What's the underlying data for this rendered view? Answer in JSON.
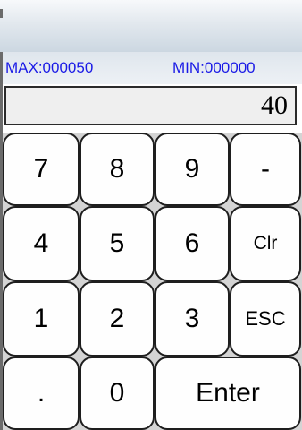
{
  "range": {
    "max_label": "MAX:000050",
    "min_label": "MIN:000000"
  },
  "display": {
    "value": "40"
  },
  "keypad": {
    "keys": {
      "seven": "7",
      "eight": "8",
      "nine": "9",
      "minus": "-",
      "four": "4",
      "five": "5",
      "six": "6",
      "clear": "Clr",
      "one": "1",
      "two": "2",
      "three": "3",
      "escape": "ESC",
      "dot": ".",
      "zero": "0",
      "enter": "Enter"
    }
  },
  "colors": {
    "range_text": "#1a1ae6",
    "display_bg": "#efefef",
    "key_bg": "#fefefe",
    "keypad_bg": "#d4d4d4"
  }
}
